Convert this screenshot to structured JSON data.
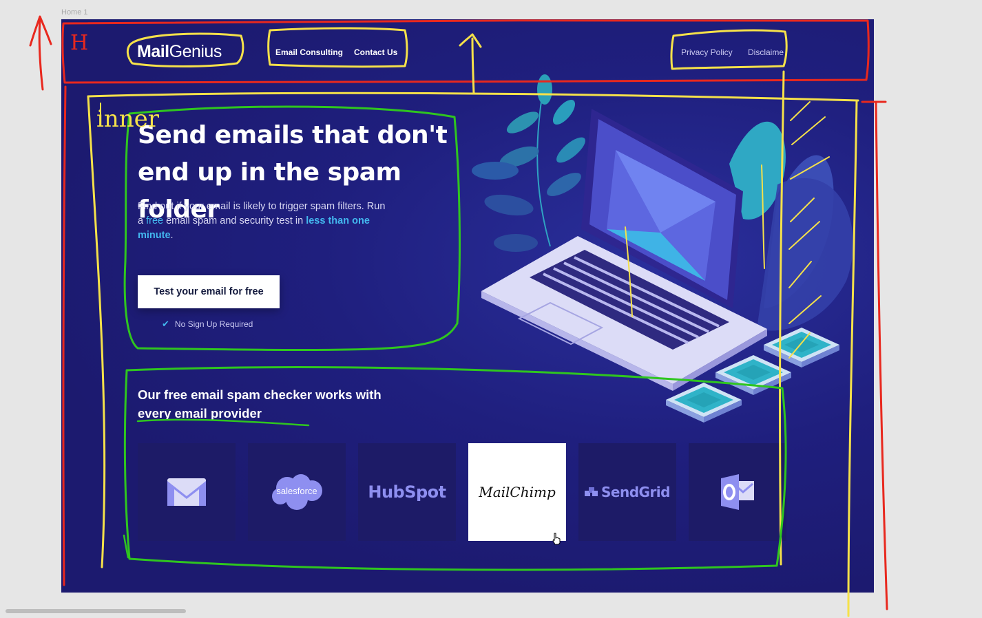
{
  "canvas": {
    "frame_label": "Home 1"
  },
  "header": {
    "logo_bold": "Mail",
    "logo_light": "Genius",
    "nav_left": [
      "Email Consulting",
      "Contact Us"
    ],
    "nav_right": [
      "Privacy Policy",
      "Disclaime"
    ]
  },
  "hero": {
    "headline": "Send emails that don't end up in the spam folder",
    "subtitle_part1": "Find out if your email is likely to trigger spam filters. Run a ",
    "subtitle_free": "free",
    "subtitle_part2": " email spam and security test in ",
    "subtitle_time": "less than one minute",
    "subtitle_end": ".",
    "cta_label": "Test your email for free",
    "no_signup": "No Sign Up Required"
  },
  "providers": {
    "title": "Our free email spam checker works with every email provider",
    "items": [
      {
        "name": "Gmail",
        "label": "",
        "icon": "gmail-icon"
      },
      {
        "name": "Salesforce",
        "label": "salesforce",
        "icon": "salesforce-icon"
      },
      {
        "name": "HubSpot",
        "label": "HubSpot",
        "icon": "hubspot-logo"
      },
      {
        "name": "MailChimp",
        "label": "MailChimp",
        "icon": "mailchimp-logo",
        "hovered": true
      },
      {
        "name": "SendGrid",
        "label": "SendGrid",
        "icon": "sendgrid-logo"
      },
      {
        "name": "Outlook",
        "label": "",
        "icon": "outlook-icon"
      }
    ]
  },
  "annotations": {
    "header_mark": "H",
    "inner_mark": "inner"
  },
  "colors": {
    "background": "#1e1c75",
    "accent": "#43b8ef",
    "tile": "#1d1b67",
    "tile_logo": "#8e8ff0",
    "button_bg": "#ffffff",
    "annotation_red": "#e8281e",
    "annotation_yellow": "#f5e14a",
    "annotation_green": "#2fc61f"
  }
}
